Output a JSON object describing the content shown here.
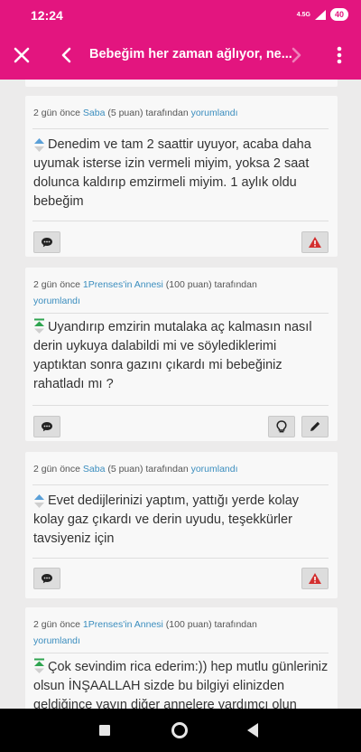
{
  "status": {
    "time": "12:24",
    "network": "4.5G",
    "battery": "40"
  },
  "app_bar": {
    "title": "Bebeğim her zaman ağlıyor, ne..."
  },
  "comments": [
    {
      "meta_prefix": "2 gün önce ",
      "author": "Saba",
      "points": "(5 puan)",
      "meta_suffix": " tarafından ",
      "action_link": "yorumlandı",
      "text": "Denedim ve tam 2 saattir uyuyor, acaba daha uyumak isterse izin vermeli miyim, yoksa 2 saat dolunca kaldırıp emzirmeli miyim. 1 aylık oldu bebeğim",
      "buttons": [
        "comment",
        "report"
      ]
    },
    {
      "meta_prefix": "2 gün önce ",
      "author": "1Prenses'in Annesi",
      "points": "(100 puan)",
      "meta_suffix": " tarafından ",
      "action_link": "yorumlandı",
      "text": "Uyandırıp emzirin mutalaka aç kalmasın nasıl derin uykuya dalabildi mi ve söylediklerimi yaptıktan sonra gazını çıkardı mi bebeğiniz rahatladı mı ?",
      "buttons": [
        "comment",
        "idea",
        "edit"
      ]
    },
    {
      "meta_prefix": "2 gün önce ",
      "author": "Saba",
      "points": "(5 puan)",
      "meta_suffix": " tarafından ",
      "action_link": "yorumlandı",
      "text": "Evet dedijlerinizi yaptım, yattığı yerde kolay kolay gaz çıkardı ve derin uyudu, teşekkürler tavsiyeniz için",
      "buttons": [
        "comment",
        "report"
      ]
    },
    {
      "meta_prefix": "2 gün önce ",
      "author": "1Prenses'in Annesi",
      "points": "(100 puan)",
      "meta_suffix": " tarafından ",
      "action_link": "yorumlandı",
      "text": "Çok sevindim rica ederim:)) hep mutlu günleriniz olsun İNŞAALLAH sizde bu bilgiyi elinizden geldiğince yayın diğer annelere yardımcı olun",
      "buttons": []
    }
  ],
  "colors": {
    "brand": "#e3157f",
    "link": "#3a8dbe",
    "vote_up": "#5aa0d8",
    "vote_best": "#2ea44f",
    "alert": "#d32f2f"
  },
  "icons": {
    "close": "close-icon",
    "back": "chevron-left-icon",
    "forward": "chevron-right-icon",
    "more": "more-vert-icon"
  }
}
